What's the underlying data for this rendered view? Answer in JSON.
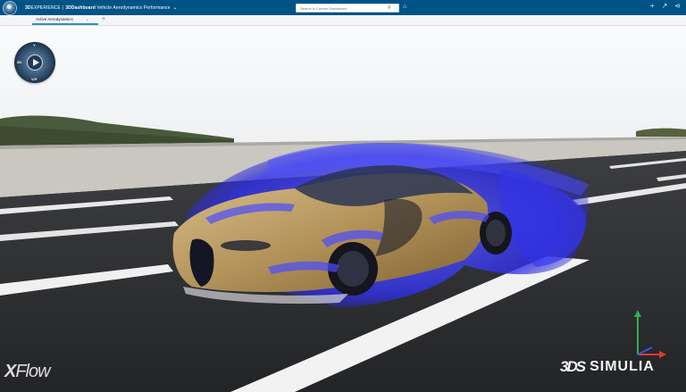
{
  "topbar": {
    "brand_prefix": "3D",
    "brand_name": "EXPERIENCE",
    "separator": "|",
    "app_prefix": "3D",
    "app_name": "Dashboard",
    "dashboard_title": "Vehicle Aerodynamics Performance",
    "search_placeholder": "Search in Current Dashboard",
    "icons": [
      "compass-logo-icon",
      "search-icon",
      "tag-icon",
      "add-icon",
      "share-icon",
      "network-icon"
    ]
  },
  "tabs": [
    {
      "label": "Active Aerodynamics",
      "active": true
    }
  ],
  "tab_add_label": "+",
  "viewer": {
    "compass": {
      "top": "Y",
      "left": "3D",
      "bottom": "V,R"
    },
    "product_logo": {
      "x": "X",
      "flow": "Flow"
    },
    "brand_logo": {
      "mark": "3DS",
      "name": "SIMULIA"
    },
    "axis_triad": [
      "y-axis",
      "x-axis",
      "z-axis"
    ]
  },
  "colors": {
    "topbar": "#005386",
    "flow_particles": "#3a3cff",
    "car_body": "#b99a5e",
    "road": "#2b2c2e",
    "sky": "#f6f7f8"
  }
}
